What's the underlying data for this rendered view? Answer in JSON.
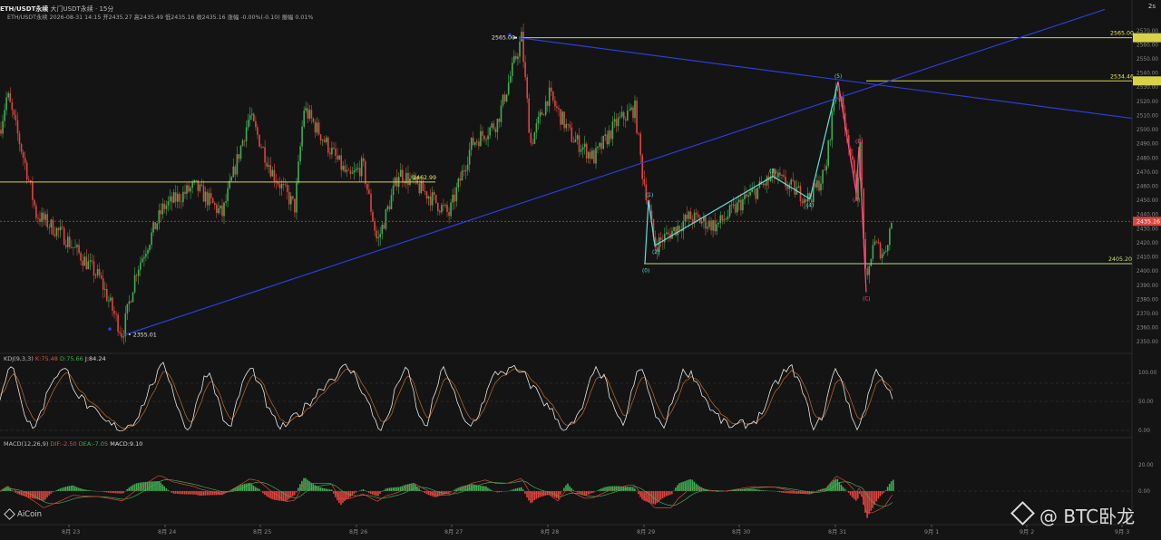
{
  "header": {
    "symbol": "ETH/USDT永续",
    "exchange": "大门USDT永续",
    "interval": "· 15分",
    "info": "ETH/USDT永续 2026-08-31 14:15 开2435.27 高2435.49 低2435.16 收2435.16 涨幅 -0.00%(-0.10) 振幅 0.01%",
    "top_right": "2s"
  },
  "kdj": {
    "name": "KDJ(9,3,3)",
    "k": "K:75.48",
    "d": "D:75.66",
    "j": "J:84.24"
  },
  "macd": {
    "name": "MACD(12,26,9)",
    "dif": "DIF:-2.50",
    "dea": "DEA:-7.05",
    "macd": "MACD:9.10"
  },
  "logo": "AiCoin",
  "watermark": "@ BTC卧龙",
  "colors": {
    "up": "#3fae52",
    "down": "#e0443e",
    "wave_up": "#5ee0dc",
    "wave_down": "#ff4d8a",
    "level": "#d8d24a",
    "trend": "#2b3ed8"
  },
  "chart_data": {
    "type": "candlestick",
    "price_axis": [
      2570,
      2560,
      2550,
      2540,
      2530,
      2520,
      2510,
      2500,
      2490,
      2480,
      2470,
      2460,
      2450,
      2440,
      2430,
      2420,
      2410,
      2400,
      2390,
      2380,
      2370,
      2360,
      2350
    ],
    "price_axis_labels": [
      "2570.00",
      "2560.00",
      "2550.00",
      "2540.00",
      "2530.00",
      "2520.00",
      "2510.00",
      "2500.00",
      "2490.00",
      "2480.00",
      "2470.00",
      "2460.00",
      "2450.00",
      "2440.00",
      "2430.00",
      "2420.00",
      "2410.00",
      "2400.00",
      "2390.00",
      "2380.00",
      "2370.00",
      "2360.00",
      "2350.00"
    ],
    "dates": [
      "8月 23",
      "8月 24",
      "8月 25",
      "8月 26",
      "8月 27",
      "8月 28",
      "8月 29",
      "8月 30",
      "8月 31",
      "9月 1",
      "9月 2",
      "9月 3"
    ],
    "last_price": 2435.16,
    "last_price_label": "2435.16",
    "levels": [
      {
        "value": 2565.0,
        "label": "2565.00"
      },
      {
        "value": 2534.46,
        "label": "2534.46"
      },
      {
        "value": 2462.99,
        "label": "2462.99"
      },
      {
        "value": 2405.2,
        "label": "2405.20"
      }
    ],
    "annotations": [
      {
        "label": "2565.00",
        "price": 2565.0
      },
      {
        "label": "2355.01",
        "price": 2355.01
      },
      {
        "label": "2462.99",
        "price": 2462.99
      }
    ],
    "wave_points": [
      {
        "label": "(0)",
        "price": 2405
      },
      {
        "label": "(1)",
        "price": 2450
      },
      {
        "label": "(2)",
        "price": 2418
      },
      {
        "label": "(3)",
        "price": 2467
      },
      {
        "label": "(4)",
        "price": 2451
      },
      {
        "label": "(5)",
        "price": 2534
      },
      {
        "label": "(A)",
        "price": 2455
      },
      {
        "label": "(B)",
        "price": 2488
      },
      {
        "label": "(C)",
        "price": 2385
      }
    ],
    "kdj_axis": [
      "100.00",
      "50.00",
      "0.00"
    ],
    "macd_axis": [
      "20.00",
      "0.00"
    ]
  }
}
